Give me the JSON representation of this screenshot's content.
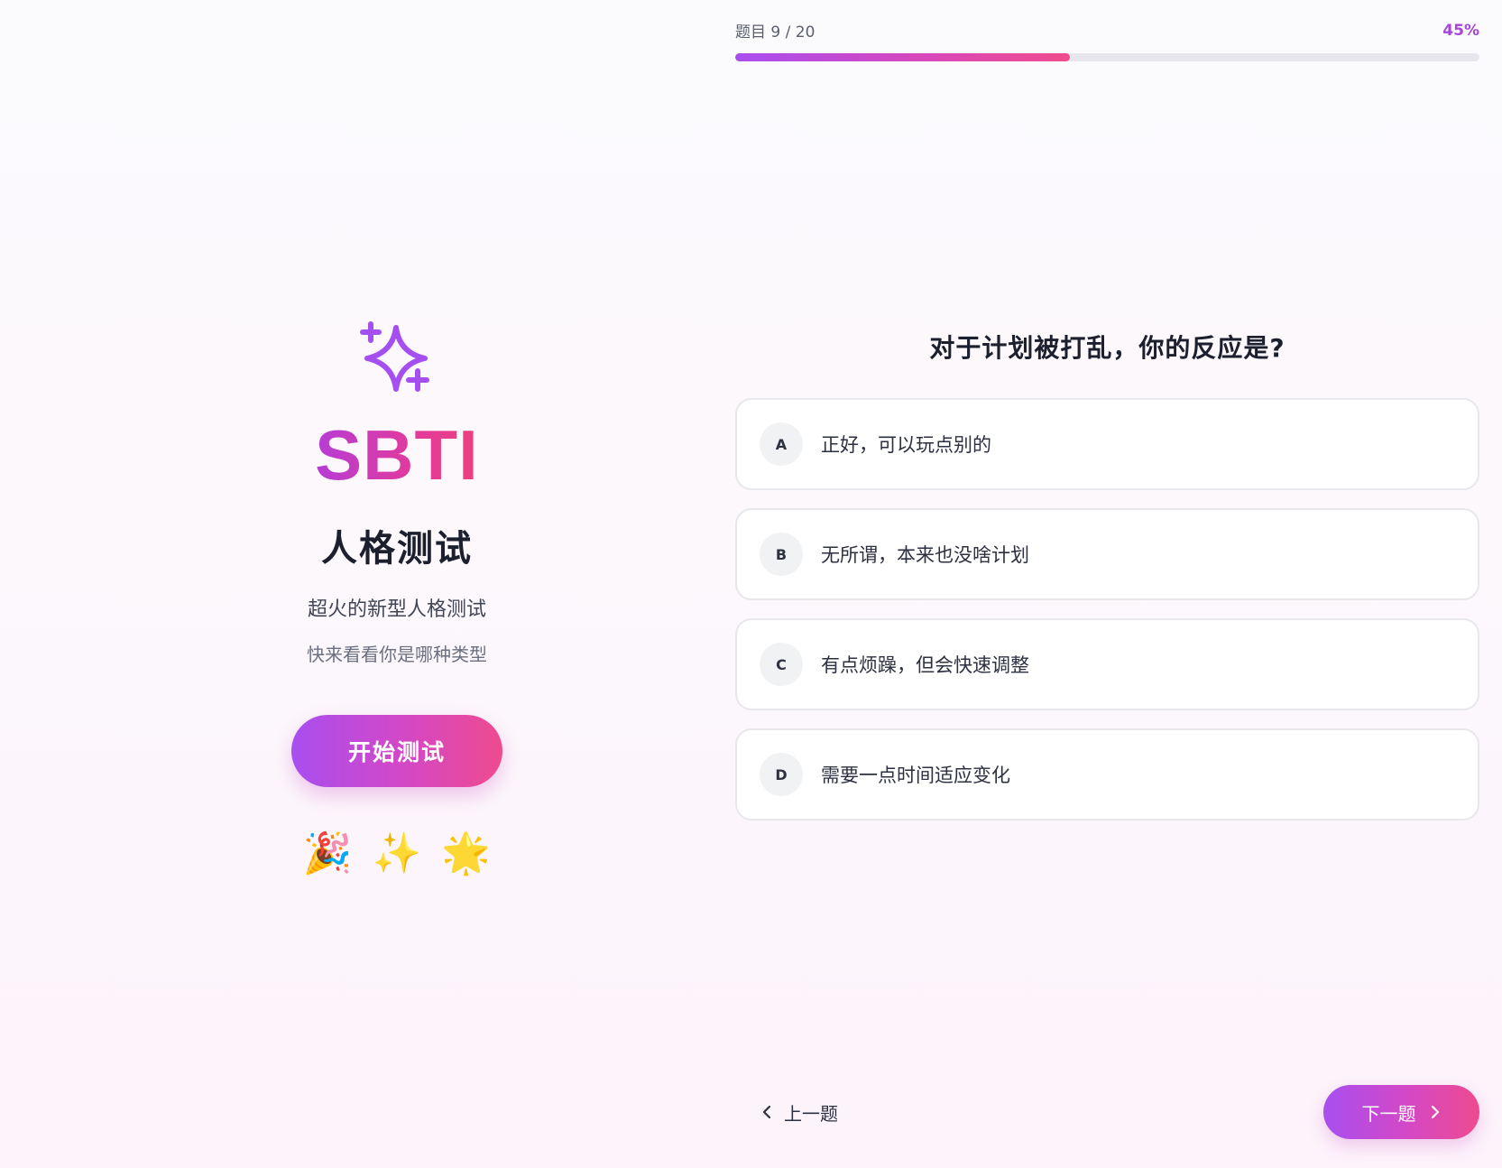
{
  "intro": {
    "icon": "sparkle-icon",
    "brand": "SBTI",
    "title": "人格测试",
    "subtitle": "超火的新型人格测试",
    "tagline": "快来看看你是哪种类型",
    "start_label": "开始测试",
    "emojis": [
      "🎉",
      "✨",
      "🌟"
    ]
  },
  "quiz": {
    "progress_label": "题目 9 / 20",
    "progress_percent_text": "45%",
    "progress_fraction": 0.45,
    "question": "对于计划被打乱，你的反应是?",
    "options": [
      {
        "key": "A",
        "text": "正好，可以玩点别的"
      },
      {
        "key": "B",
        "text": "无所谓，本来也没啥计划"
      },
      {
        "key": "C",
        "text": "有点烦躁，但会快速调整"
      },
      {
        "key": "D",
        "text": "需要一点时间适应变化"
      }
    ],
    "prev_label": "上一题",
    "next_label": "下一题"
  },
  "colors": {
    "accent_purple": "#a84ef0",
    "accent_pink": "#ee4a8e",
    "icon_purple": "#a64ff0"
  }
}
